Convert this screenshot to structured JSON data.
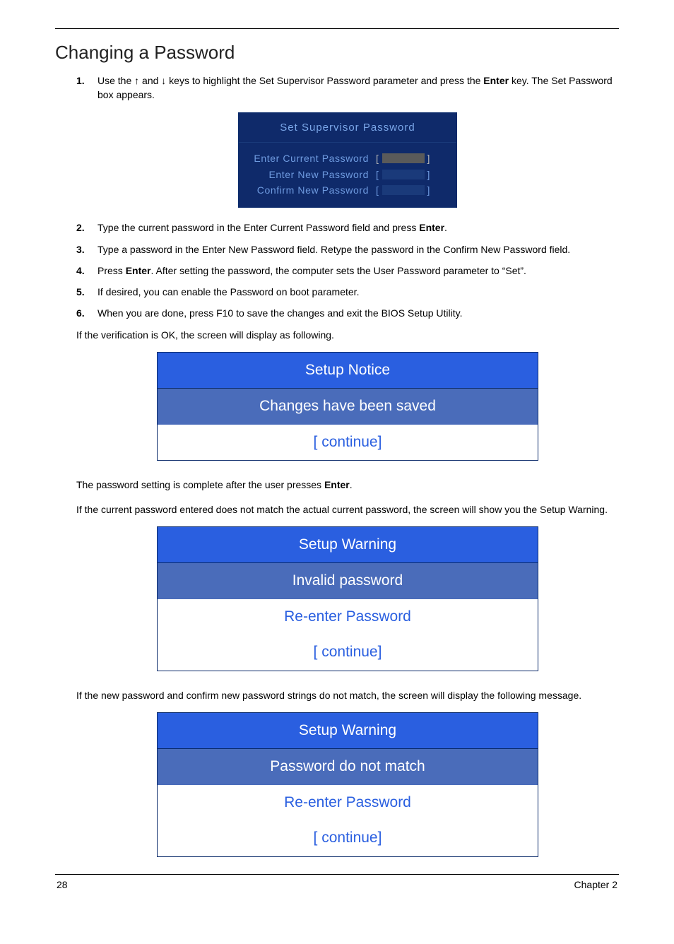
{
  "heading": "Changing a Password",
  "steps1": [
    {
      "num": "1.",
      "html": "Use the <span class='arrow'>↑</span> and <span class='arrow'>↓</span> keys to highlight the Set Supervisor Password parameter and press the <b>Enter</b> key. The Set Password box appears."
    }
  ],
  "pwDialog": {
    "title": "Set Supervisor Password",
    "rows": [
      {
        "label": "Enter Current Password",
        "highlight": true
      },
      {
        "label": "Enter New Password",
        "highlight": false
      },
      {
        "label": "Confirm New Password",
        "highlight": false
      }
    ]
  },
  "steps2": [
    {
      "num": "2.",
      "html": "Type the current password in the Enter Current Password field and press <b>Enter</b>."
    },
    {
      "num": "3.",
      "html": "Type a password in the Enter New Password field. Retype the password in the Confirm New Password field."
    },
    {
      "num": "4.",
      "html": "Press <b>Enter</b>. After setting the password, the computer sets the User Password parameter to “Set”."
    },
    {
      "num": "5.",
      "html": "If desired, you can enable the Password on boot parameter."
    },
    {
      "num": "6.",
      "html": "When you are done, press F10 to save the changes and exit the BIOS Setup Utility."
    }
  ],
  "para1": "If the verification is OK, the screen will display as following.",
  "dlg1": {
    "title": "Setup Notice",
    "rows": [
      {
        "text": "Changes have been saved",
        "cls": "dlg-row"
      },
      {
        "text": "[ continue]",
        "cls": "dlg-row-light"
      }
    ]
  },
  "para2_html": "The password setting is complete after the user presses <b>Enter</b>.",
  "para3": "If the current password entered does not match the actual current password, the screen will show you the Setup Warning.",
  "dlg2": {
    "title": "Setup Warning",
    "rows": [
      {
        "text": "Invalid password",
        "cls": "dlg-row"
      },
      {
        "text": "Re-enter Password",
        "cls": "dlg-row-light"
      },
      {
        "text": "[ continue]",
        "cls": "dlg-row-light"
      }
    ]
  },
  "para4": "If the new password and confirm new password strings do not match, the screen will display the following message.",
  "dlg3": {
    "title": "Setup Warning",
    "rows": [
      {
        "text": "Password do not match",
        "cls": "dlg-row"
      },
      {
        "text": "Re-enter Password",
        "cls": "dlg-row-light"
      },
      {
        "text": "[ continue]",
        "cls": "dlg-row-light"
      }
    ]
  },
  "footer": {
    "pageNum": "28",
    "chapter": "Chapter 2"
  }
}
